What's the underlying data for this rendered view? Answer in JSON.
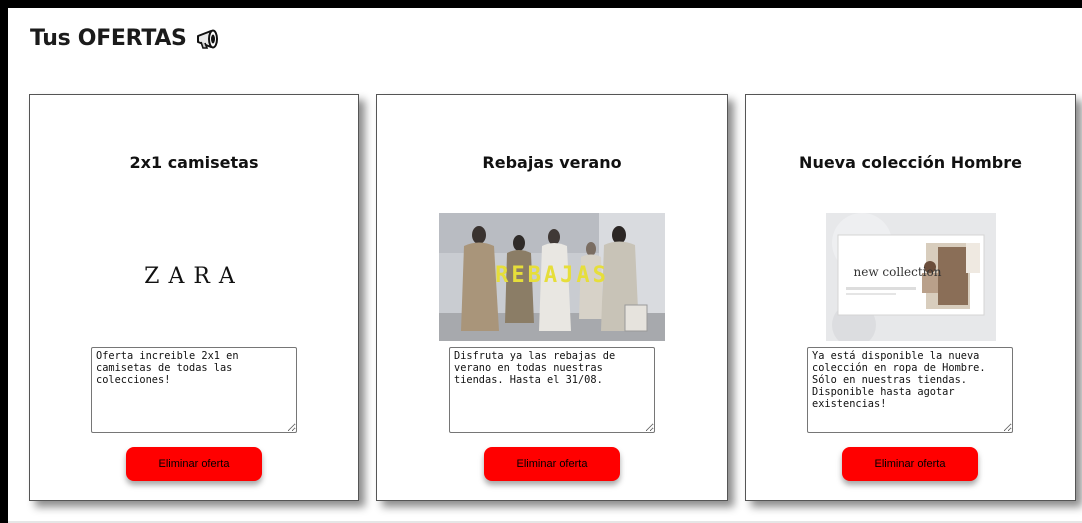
{
  "page": {
    "title": "Tus OFERTAS"
  },
  "icons": {
    "title_icon": "megaphone-icon"
  },
  "colors": {
    "accent": "#ff0000",
    "frame": "#000000"
  },
  "offers": [
    {
      "title": "2x1 camisetas",
      "image_text": "ZARA",
      "description": "Oferta increible 2x1 en camisetas de todas las colecciones!",
      "button_label": "Eliminar oferta"
    },
    {
      "title": "Rebajas verano",
      "image_text": "REBAJAS",
      "description": "Disfruta ya las rebajas de verano en todas nuestras tiendas. Hasta el 31/08.",
      "button_label": "Eliminar oferta"
    },
    {
      "title": "Nueva colección Hombre",
      "image_text": "new collection",
      "description": "Ya está disponible la nueva colección en ropa de Hombre. Sólo en nuestras tiendas. Disponible hasta agotar existencias!",
      "button_label": "Eliminar oferta"
    }
  ]
}
